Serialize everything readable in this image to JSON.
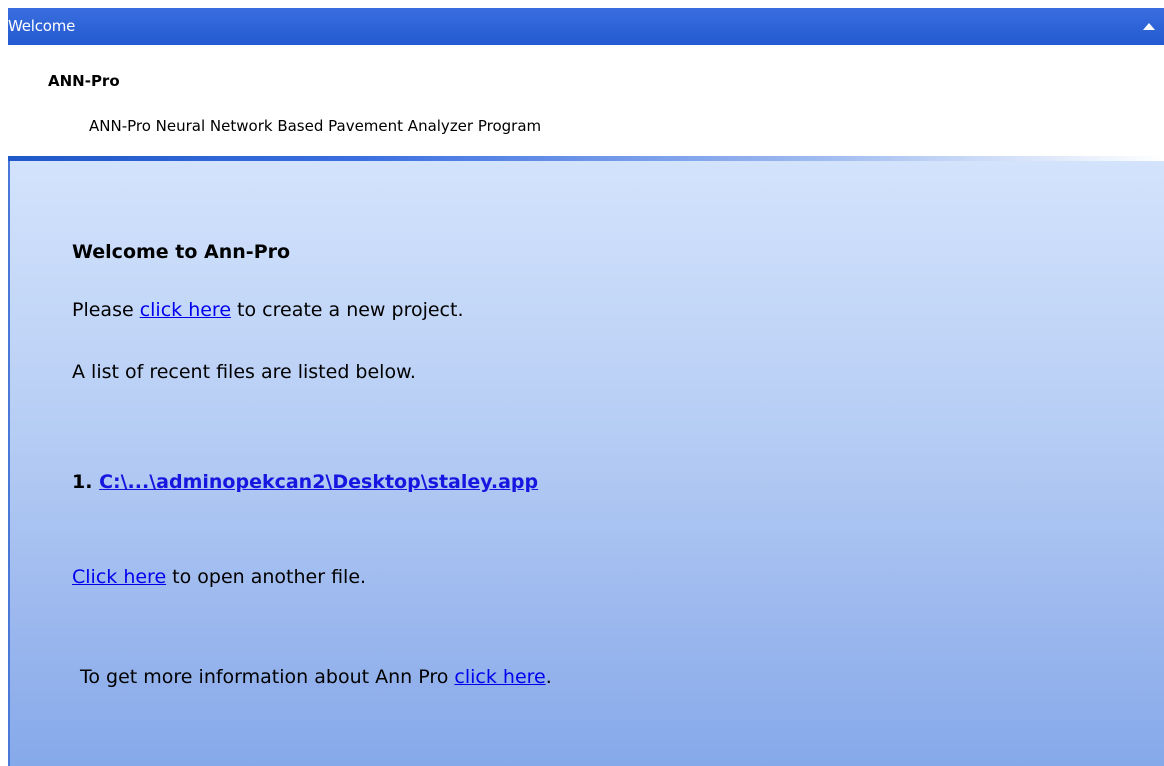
{
  "titlebar": {
    "title": "Welcome",
    "collapse_icon": "chevron-up-icon"
  },
  "header": {
    "app_name": "ANN-Pro",
    "description": "ANN-Pro Neural Network Based Pavement Analyzer Program"
  },
  "content": {
    "heading": "Welcome to Ann-Pro",
    "new_project": {
      "prefix": "Please ",
      "link": "click here",
      "suffix": " to create a new project."
    },
    "recent_intro": "A list of recent files are listed below.",
    "recent_files": [
      {
        "index": "1.",
        "path": "C:\\...\\adminopekcan2\\Desktop\\staley.app"
      }
    ],
    "open_file": {
      "link": "Click here",
      "suffix": " to open another file."
    },
    "more_info": {
      "prefix": "To get more information about Ann Pro ",
      "link": "click here",
      "suffix": "."
    }
  }
}
